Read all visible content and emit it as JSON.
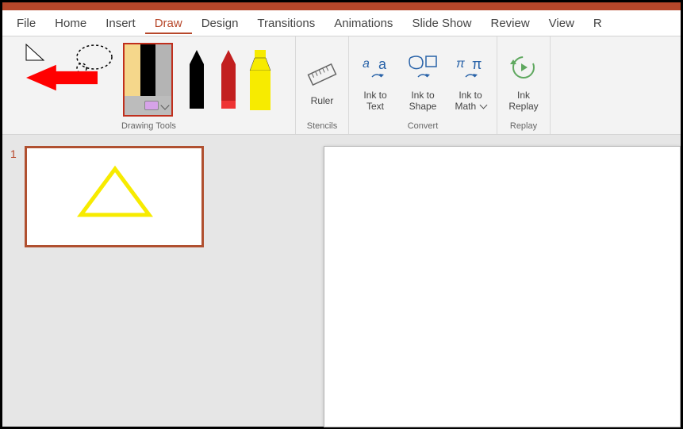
{
  "tabs": {
    "file": "File",
    "home": "Home",
    "insert": "Insert",
    "draw": "Draw",
    "design": "Design",
    "transitions": "Transitions",
    "animations": "Animations",
    "slideshow": "Slide Show",
    "review": "Review",
    "view": "View",
    "recording": "R"
  },
  "groups": {
    "drawing": "Drawing Tools",
    "stencils": "Stencils",
    "convert": "Convert",
    "replay": "Replay"
  },
  "buttons": {
    "ruler": "Ruler",
    "ink_to_text": "Ink to\nText",
    "ink_to_shape": "Ink to\nShape",
    "ink_to_math": "Ink to\nMath ",
    "ink_replay": "Ink\nReplay"
  },
  "pens": {
    "black": "pen-black",
    "red": "pen-red",
    "highlighter": "highlighter-yellow"
  },
  "slides": {
    "current_number": "1"
  },
  "colors": {
    "accent": "#b7472a",
    "pen_black": "#000000",
    "pen_red": "#d22f2f",
    "highlighter": "#f7eb00",
    "triangle": "#f7eb00"
  }
}
